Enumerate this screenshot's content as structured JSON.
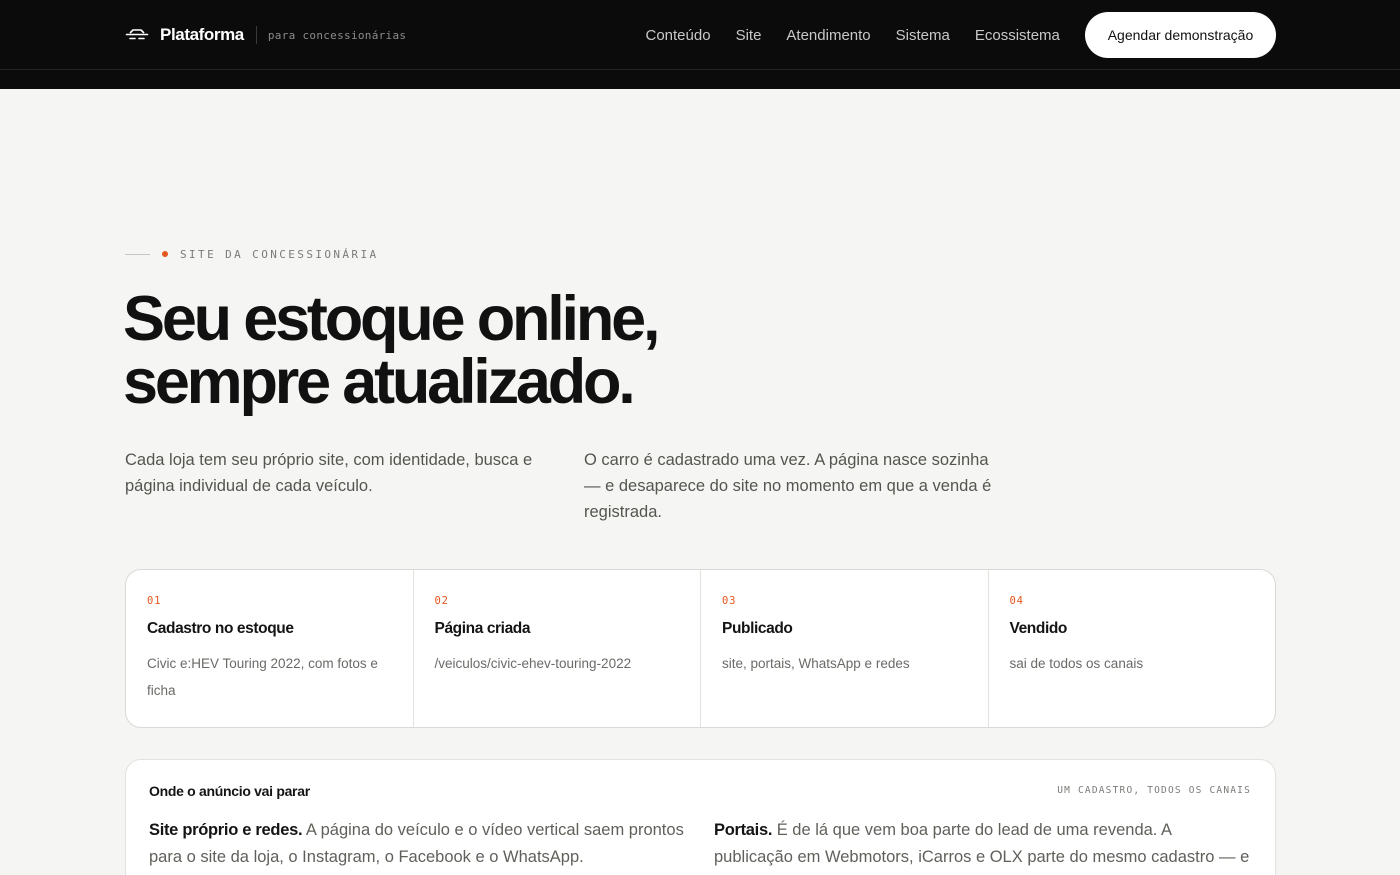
{
  "header": {
    "brand_name": "Plataforma",
    "brand_tag": "para concessionárias",
    "nav": [
      "Conteúdo",
      "Site",
      "Atendimento",
      "Sistema",
      "Ecossistema"
    ],
    "cta_label": "Agendar demonstração"
  },
  "hero": {
    "eyebrow": "SITE DA CONCESSIONÁRIA",
    "title_line1": "Seu estoque online,",
    "title_line2": "sempre atualizado.",
    "lead_left": "Cada loja tem seu próprio site, com identidade, busca e página individual de cada veículo.",
    "lead_right": "O carro é cadastrado uma vez. A página nasce sozinha — e desaparece do site no momento em que a venda é registrada."
  },
  "steps": [
    {
      "num": "01",
      "title": "Cadastro no estoque",
      "desc": "Civic e:HEV Touring 2022, com fotos e ficha"
    },
    {
      "num": "02",
      "title": "Página criada",
      "desc": "/veiculos/civic-ehev-touring-2022"
    },
    {
      "num": "03",
      "title": "Publicado",
      "desc": "site, portais, WhatsApp e redes"
    },
    {
      "num": "04",
      "title": "Vendido",
      "desc": "sai de todos os canais"
    }
  ],
  "channels": {
    "title": "Onde o anúncio vai parar",
    "tag": "UM CADASTRO, TODOS OS CANAIS",
    "left_lead": "Site próprio e redes.",
    "left_text": " A página do veículo e o vídeo vertical saem prontos para o site da loja, o Instagram, o Facebook e o WhatsApp.",
    "right_lead": "Portais.",
    "right_text": " É de lá que vem boa parte do lead de uma revenda. A publicação em Webmotors, iCarros e OLX parte do mesmo cadastro — e a baixa na"
  },
  "colors": {
    "accent": "#e4571e",
    "header_bg": "#0b0b0b",
    "page_bg": "#f5f5f3"
  },
  "icons": {
    "brand": "car-icon"
  }
}
